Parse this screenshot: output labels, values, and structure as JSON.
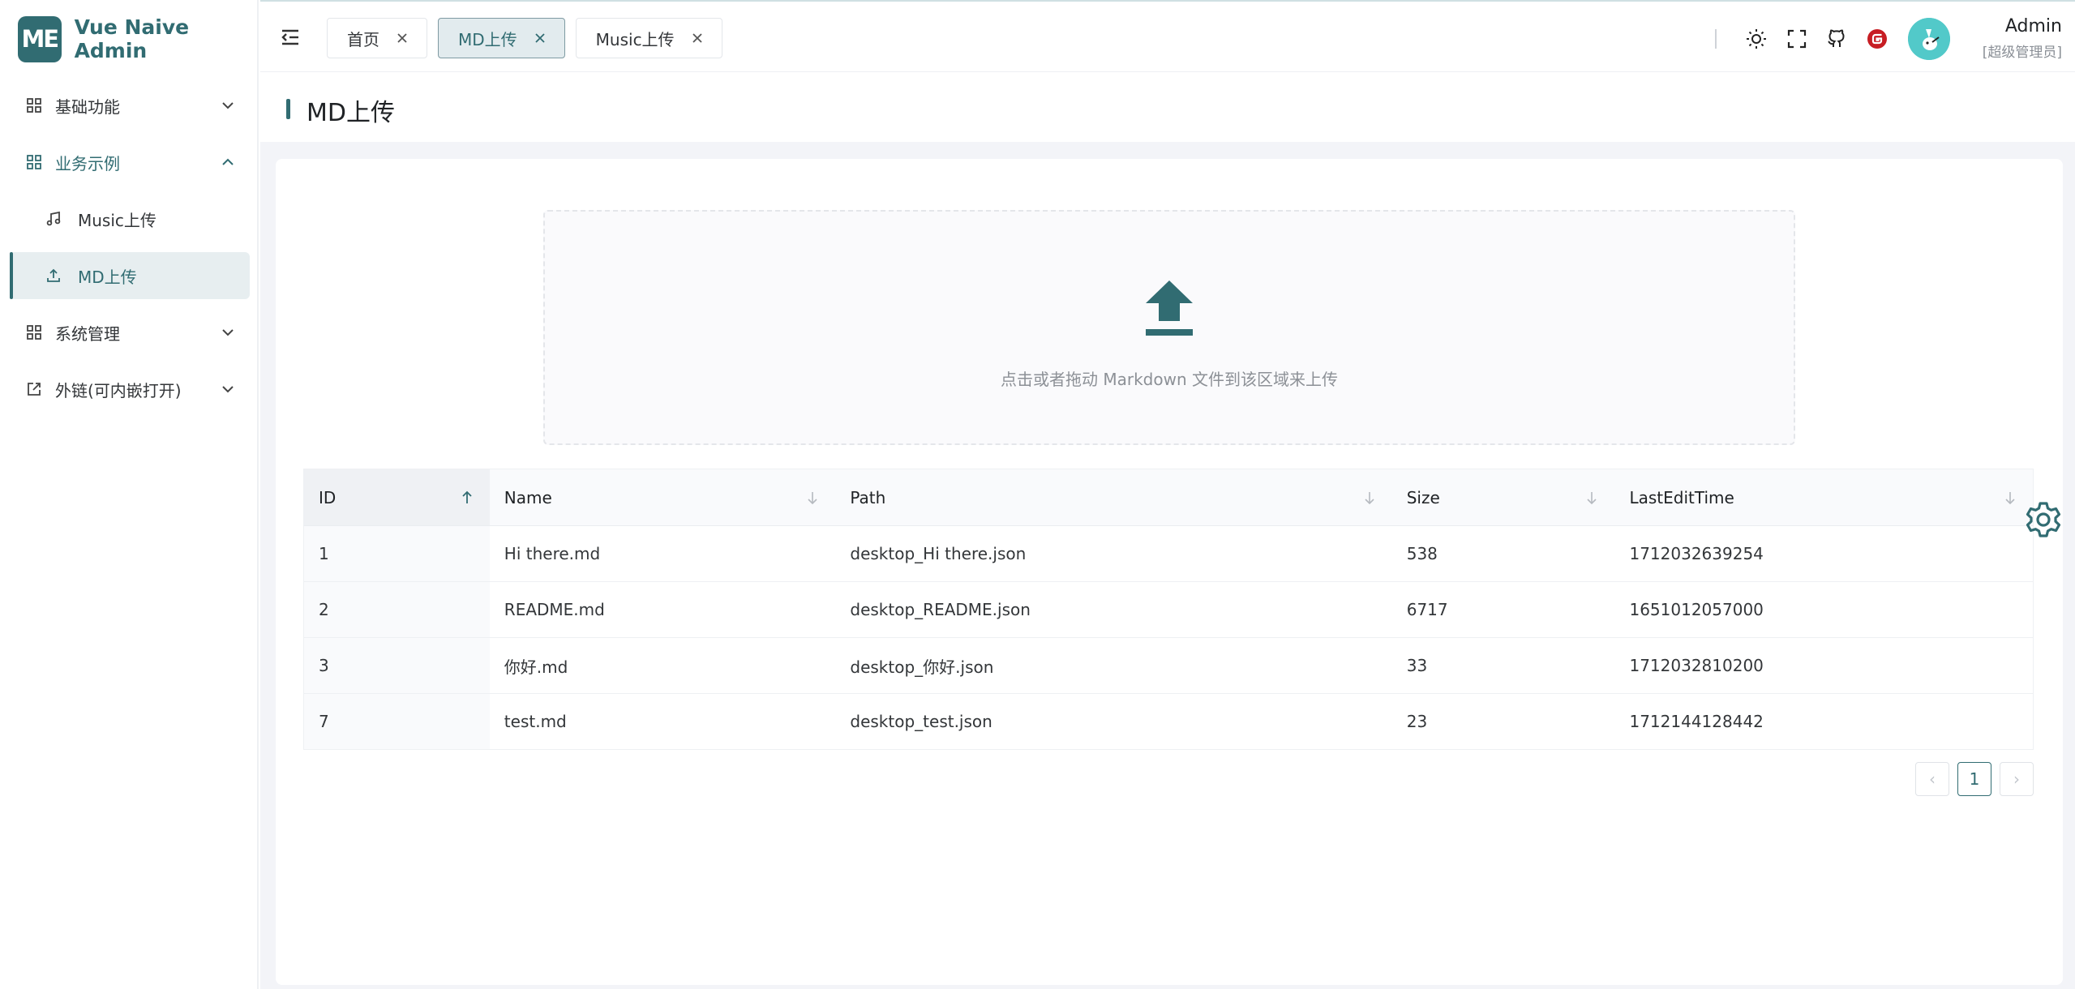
{
  "app": {
    "logo_text": "ME",
    "name": "Vue Naive Admin"
  },
  "sidebar": {
    "items": [
      {
        "label": "基础功能",
        "icon": "grid-icon",
        "expanded": false
      },
      {
        "label": "业务示例",
        "icon": "grid-icon",
        "expanded": true
      },
      {
        "label": "Music上传",
        "icon": "music-note-icon",
        "sub": true
      },
      {
        "label": "MD上传",
        "icon": "upload-icon",
        "sub": true,
        "active": true
      },
      {
        "label": "系统管理",
        "icon": "grid-icon",
        "expanded": false
      },
      {
        "label": "外链(可内嵌打开)",
        "icon": "external-link-icon",
        "expanded": false
      }
    ]
  },
  "header": {
    "tabs": [
      {
        "label": "首页",
        "active": false
      },
      {
        "label": "MD上传",
        "active": true
      },
      {
        "label": "Music上传",
        "active": false
      }
    ],
    "icons": [
      "sun-icon",
      "fullscreen-icon",
      "github-icon",
      "gitee-icon"
    ],
    "user": {
      "name": "Admin",
      "role": "[超级管理员]"
    }
  },
  "page": {
    "title": "MD上传"
  },
  "upload": {
    "hint": "点击或者拖动 Markdown 文件到该区域来上传",
    "icon": "upload-arrow-icon"
  },
  "table": {
    "columns": [
      "ID",
      "Name",
      "Path",
      "Size",
      "LastEditTime"
    ],
    "sort": {
      "column": "ID",
      "direction": "asc"
    },
    "rows": [
      [
        "1",
        "Hi there.md",
        "desktop_Hi there.json",
        "538",
        "1712032639254"
      ],
      [
        "2",
        "README.md",
        "desktop_README.json",
        "6717",
        "1651012057000"
      ],
      [
        "3",
        "你好.md",
        "desktop_你好.json",
        "33",
        "1712032810200"
      ],
      [
        "7",
        "test.md",
        "desktop_test.json",
        "23",
        "1712144128442"
      ]
    ]
  },
  "pagination": {
    "prev": "‹",
    "current": "1",
    "next": "›"
  },
  "colors": {
    "primary": "#316c72",
    "active_bg": "#e7eef0",
    "content_bg": "#f3f4f8",
    "avatar_bg": "#52c9c9",
    "gitee_red": "#c71d23"
  }
}
